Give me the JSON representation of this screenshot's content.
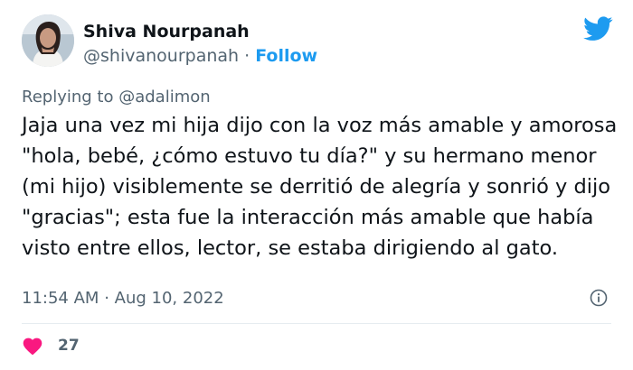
{
  "user": {
    "display_name": "Shiva Nourpanah",
    "handle": "@shivanourpanah",
    "separator": "·",
    "follow_label": "Follow"
  },
  "icons": {
    "platform": "twitter-bird-icon",
    "info": "info-icon",
    "like": "heart-icon"
  },
  "reply": {
    "prefix": "Replying to",
    "mention": "@adalimon"
  },
  "tweet": {
    "text": "Jaja una vez mi hija dijo con la voz más amable y amorosa \"hola, bebé, ¿cómo estuvo tu día?\" y su hermano menor (mi hijo) visiblemente se derritió de alegría y sonrió y dijo \"gracias\"; esta fue la interacción más amable que había visto entre ellos, lector, se estaba dirigiendo al gato.",
    "time": "11:54 AM",
    "separator": "·",
    "date": "Aug 10, 2022"
  },
  "engagement": {
    "likes": "27"
  },
  "colors": {
    "accent": "#1d9bf0",
    "heart": "#f91880",
    "muted_text": "#536471",
    "primary_text": "#0f1419"
  }
}
